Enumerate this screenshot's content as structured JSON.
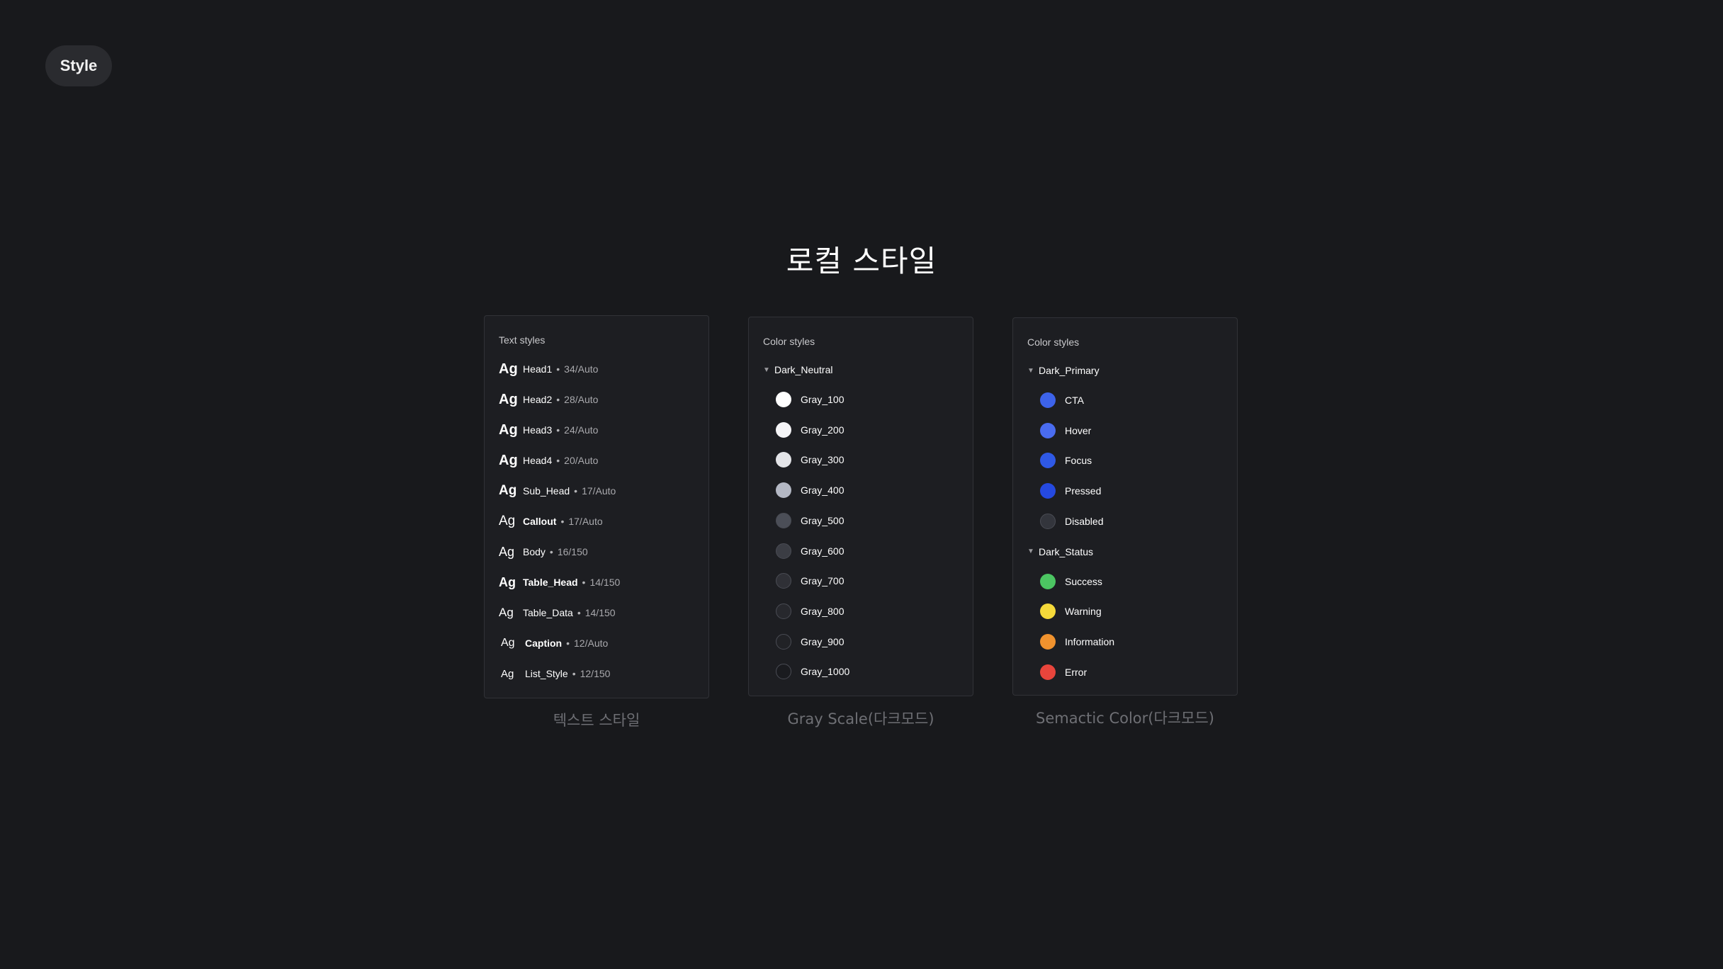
{
  "badge": {
    "label": "Style"
  },
  "page_title": "로컬 스타일",
  "text_panel": {
    "heading": "Text styles",
    "caption": "텍스트 스타일",
    "sample": "Ag",
    "items": [
      {
        "name": "Head1",
        "spec": "34/Auto"
      },
      {
        "name": "Head2",
        "spec": "28/Auto"
      },
      {
        "name": "Head3",
        "spec": "24/Auto"
      },
      {
        "name": "Head4",
        "spec": "20/Auto"
      },
      {
        "name": "Sub_Head",
        "spec": "17/Auto"
      },
      {
        "name": "Callout",
        "spec": "17/Auto"
      },
      {
        "name": "Body",
        "spec": "16/150"
      },
      {
        "name": "Table_Head",
        "spec": "14/150"
      },
      {
        "name": "Table_Data",
        "spec": "14/150"
      },
      {
        "name": "Caption",
        "spec": "12/Auto"
      },
      {
        "name": "List_Style",
        "spec": "12/150"
      }
    ],
    "separator": "•"
  },
  "gray_panel": {
    "heading": "Color styles",
    "caption": "Gray Scale(다크모드)",
    "group": "Dark_Neutral",
    "items": [
      {
        "name": "Gray_100",
        "color": "#ffffff"
      },
      {
        "name": "Gray_200",
        "color": "#f5f5f7"
      },
      {
        "name": "Gray_300",
        "color": "#e3e4e8"
      },
      {
        "name": "Gray_400",
        "color": "#b4b8c4"
      },
      {
        "name": "Gray_500",
        "color": "#4b4e57"
      },
      {
        "name": "Gray_600",
        "color": "#3b3d44"
      },
      {
        "name": "Gray_700",
        "color": "#2f3036"
      },
      {
        "name": "Gray_800",
        "color": "#27282d"
      },
      {
        "name": "Gray_900",
        "color": "#212226"
      },
      {
        "name": "Gray_1000",
        "color": "#1a1b1f"
      }
    ]
  },
  "semantic_panel": {
    "heading": "Color styles",
    "caption": "Semactic Color(다크모드)",
    "groups": [
      {
        "label": "Dark_Primary",
        "items": [
          {
            "name": "CTA",
            "color": "#3d63ea"
          },
          {
            "name": "Hover",
            "color": "#4a6cf0"
          },
          {
            "name": "Focus",
            "color": "#2f59e6"
          },
          {
            "name": "Pressed",
            "color": "#2549e0"
          },
          {
            "name": "Disabled",
            "color": "#33353c"
          }
        ]
      },
      {
        "label": "Dark_Status",
        "items": [
          {
            "name": "Success",
            "color": "#4cc562"
          },
          {
            "name": "Warning",
            "color": "#f5d93a"
          },
          {
            "name": "Information",
            "color": "#f0922e"
          },
          {
            "name": "Error",
            "color": "#e8453c"
          }
        ]
      }
    ]
  }
}
